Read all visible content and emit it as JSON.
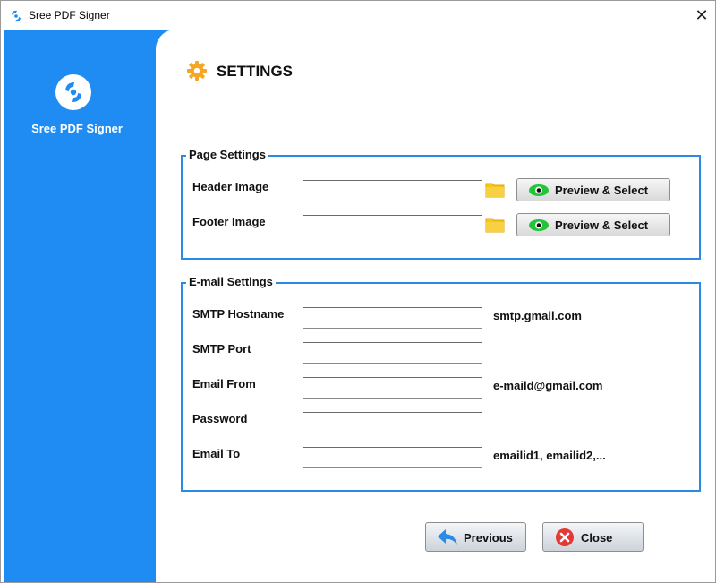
{
  "window": {
    "title": "Sree PDF Signer"
  },
  "sidebar": {
    "app_name": "Sree PDF Signer"
  },
  "header": {
    "title": "SETTINGS"
  },
  "page_settings": {
    "legend": "Page Settings",
    "header_image": {
      "label": "Header Image",
      "value": "",
      "button_label": "Preview & Select"
    },
    "footer_image": {
      "label": "Footer Image",
      "value": "",
      "button_label": "Preview & Select"
    }
  },
  "email_settings": {
    "legend": "E-mail Settings",
    "smtp_hostname": {
      "label": "SMTP Hostname",
      "value": "",
      "hint": "smtp.gmail.com"
    },
    "smtp_port": {
      "label": "SMTP Port",
      "value": ""
    },
    "email_from": {
      "label": "Email From",
      "value": "",
      "hint": "e-maild@gmail.com"
    },
    "password": {
      "label": "Password",
      "value": ""
    },
    "email_to": {
      "label": "Email To",
      "value": "",
      "hint": "emailid1, emailid2,..."
    }
  },
  "footer": {
    "previous_label": "Previous",
    "close_label": "Close"
  },
  "colors": {
    "sidebar": "#1e8cf2",
    "group_border": "#2a8ae6",
    "eye": "#22c43a",
    "close_icon": "#e53935",
    "back_arrow": "#2a8ae6",
    "folder": "#f5c518"
  },
  "icons": {
    "app": "app-logo-icon",
    "gear": "gear-icon",
    "folder": "folder-icon",
    "eye": "eye-icon",
    "back": "back-arrow-icon",
    "close": "close-circle-icon"
  }
}
